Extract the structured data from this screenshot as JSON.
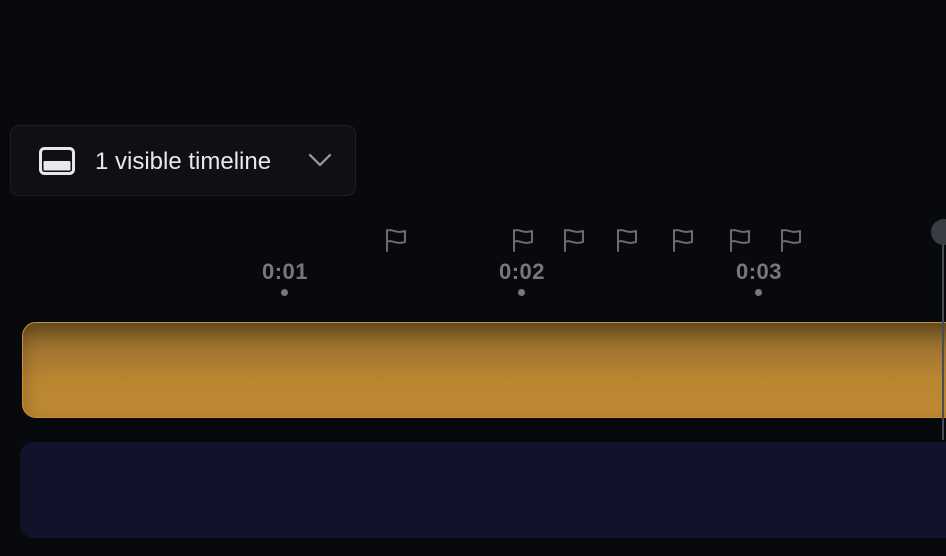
{
  "timeline_selector": {
    "label": "1 visible timeline",
    "icon": "panel-bottom-icon",
    "chevron": "chevron-down-icon"
  },
  "ruler": {
    "ticks": [
      {
        "label": "0:01"
      },
      {
        "label": "0:02"
      },
      {
        "label": "0:03"
      }
    ],
    "flag_count": 7,
    "flag_icon": "flag-icon"
  },
  "tracks": [
    {
      "name": "gold-track",
      "color": "#b98530"
    },
    {
      "name": "navy-track",
      "color": "#12122a"
    }
  ],
  "colors": {
    "background": "#08090d",
    "text_muted": "#77787d",
    "text_primary": "#e8e8ea"
  }
}
